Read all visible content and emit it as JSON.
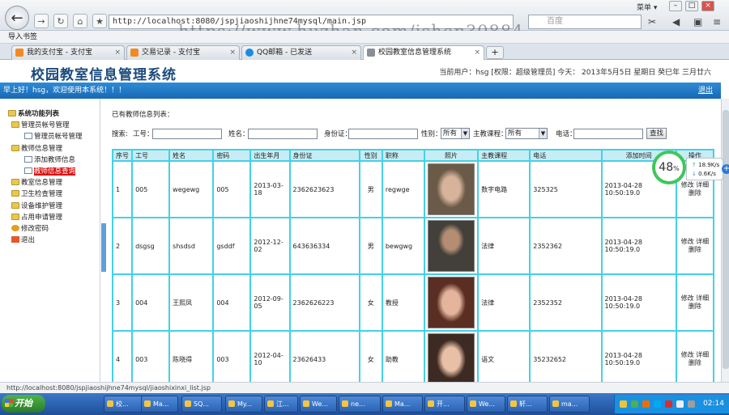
{
  "browser": {
    "url": "http://localhost:8080/jspjiaoshijhne74mysql/main.jsp",
    "search_placeholder": "百度",
    "menu_label": "菜单 ▾",
    "bookmark_label": "导入书签",
    "tabs": [
      {
        "label": "我的支付宝 - 支付宝",
        "color": "#f08a24"
      },
      {
        "label": "交易记录 - 支付宝",
        "color": "#f08a24"
      },
      {
        "label": "QQ邮箱 - 已发送",
        "color": "#1b8be0"
      },
      {
        "label": "校园教室信息管理系统",
        "color": "#8a8f96"
      }
    ],
    "new_tab": "+"
  },
  "watermark": "https://www.huzhan.com/ishop30884",
  "app": {
    "title": "校园教室信息管理系统",
    "user_info": "当前用户：hsg [权限：超级管理员] 今天： 2013年5月5日 星期日 癸巳年 三月廿六",
    "welcome": "早上好！hsg，欢迎使用本系统！！！",
    "logout": "退出"
  },
  "sidebar": {
    "items": [
      {
        "label": "系统功能列表",
        "level": 0,
        "icon": "folder-icon"
      },
      {
        "label": "管理员帐号管理",
        "level": 1,
        "icon": "folder-icon"
      },
      {
        "label": "管理员帐号管理",
        "level": 2,
        "icon": "doc-icon"
      },
      {
        "label": "教师信息管理",
        "level": 1,
        "icon": "folder-icon"
      },
      {
        "label": "添加教师信息",
        "level": 2,
        "icon": "doc-icon"
      },
      {
        "label": "教师信息查询",
        "level": 2,
        "icon": "doc-icon",
        "selected": true
      },
      {
        "label": "教室信息管理",
        "level": 1,
        "icon": "folder-icon"
      },
      {
        "label": "卫生检查管理",
        "level": 1,
        "icon": "folder-icon"
      },
      {
        "label": "设备维护管理",
        "level": 1,
        "icon": "folder-icon"
      },
      {
        "label": "占用申请管理",
        "level": 1,
        "icon": "folder-icon"
      },
      {
        "label": "修改密码",
        "level": 1,
        "icon": "key-icon"
      },
      {
        "label": "退出",
        "level": 1,
        "icon": "exit-icon"
      }
    ]
  },
  "main": {
    "list_title": "已有教师信息列表：",
    "filters": {
      "search_label": "搜索:",
      "gonghao_label": "工号：",
      "name_label": "姓名：",
      "idcard_label": "身份证：",
      "gender_label": "性别：",
      "gender_value": "所有",
      "course_label": "主教课程：",
      "course_value": "所有",
      "phone_label": "电话：",
      "search_button": "查找"
    },
    "table": {
      "headers": [
        "序号",
        "工号",
        "姓名",
        "密码",
        "出生年月",
        "身份证",
        "性别",
        "职称",
        "照片",
        "主教课程",
        "电话",
        "添加时间",
        "操作"
      ],
      "rows": [
        {
          "idx": "1",
          "id": "005",
          "name": "wegewg",
          "pwd": "005",
          "birth": "2013-03-18",
          "idcard": "2362623623",
          "gender": "男",
          "title": "regwge",
          "course": "数字电路",
          "phone": "325325",
          "added": "2013-04-28 10:50:19.0",
          "photo_bg": "#6b5a48",
          "photo_fg": "#d6b39a"
        },
        {
          "idx": "2",
          "id": "dsgsg",
          "name": "shsdsd",
          "pwd": "gsddf",
          "birth": "2012-12-02",
          "idcard": "643636334",
          "gender": "男",
          "title": "bewgwg",
          "course": "法律",
          "phone": "2352362",
          "added": "2013-04-28 10:50:19.0",
          "photo_bg": "#43403c",
          "photo_fg": "#b48d72"
        },
        {
          "idx": "3",
          "id": "004",
          "name": "王熙凤",
          "pwd": "004",
          "birth": "2012-09-05",
          "idcard": "2362626223",
          "gender": "女",
          "title": "教授",
          "course": "法律",
          "phone": "2352352",
          "added": "2013-04-28 10:50:19.0",
          "photo_bg": "#5a2e22",
          "photo_fg": "#e4b59c"
        },
        {
          "idx": "4",
          "id": "003",
          "name": "陈晓得",
          "pwd": "003",
          "birth": "2012-04-10",
          "idcard": "23626433",
          "gender": "女",
          "title": "助教",
          "course": "语文",
          "phone": "35232652",
          "added": "2013-04-28 10:50:19.0",
          "photo_bg": "#3d2a22",
          "photo_fg": "#e8c0a6"
        }
      ],
      "op_edit": "修改",
      "op_detail": "详细",
      "op_delete": "删除"
    }
  },
  "net_widget": {
    "percent": "48",
    "unit": "%",
    "up": "18.9K/s",
    "down": "0.6K/s"
  },
  "status_url": "http://localhost:8080/jspjiaoshijhne74mysql/jiaoshixinxi_list.jsp",
  "taskbar": {
    "start": "开始",
    "tasks": [
      "校...",
      "Ma...",
      "SQ...",
      "My...",
      "江...",
      "We...",
      "ne...",
      "Ma...",
      "开...",
      "We...",
      "轩...",
      "ma..."
    ],
    "clock": "02:14"
  }
}
